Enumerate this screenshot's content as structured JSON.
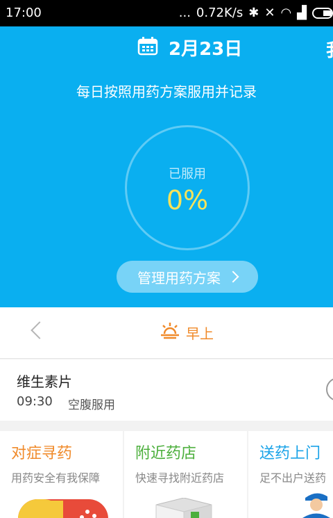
{
  "status_bar": {
    "time": "17:00",
    "network_speed": "0.72K/s",
    "dots": "..."
  },
  "header": {
    "date": "2月23日",
    "edge_text": "我",
    "subtitle": "每日按照用药方案服用并记录",
    "progress": {
      "label": "已服用",
      "value": "0%",
      "fraction": 0.0
    },
    "manage_button": "管理用药方案"
  },
  "period": {
    "label": "早上"
  },
  "medicine": {
    "name": "维生素片",
    "time": "09:30",
    "note": "空腹服用"
  },
  "cards": [
    {
      "title": "对症寻药",
      "subtitle": "用药安全有我保障",
      "color": "#f08a2a"
    },
    {
      "title": "附近药店",
      "subtitle": "快速寻找附近药店",
      "color": "#4caf3c"
    },
    {
      "title": "送药上门",
      "subtitle": "足不出户送药",
      "color": "#1aa3e8"
    }
  ],
  "colors": {
    "primary_blue": "#0aaff0",
    "accent_orange": "#f08a2a",
    "progress_yellow": "#f7e35b"
  }
}
